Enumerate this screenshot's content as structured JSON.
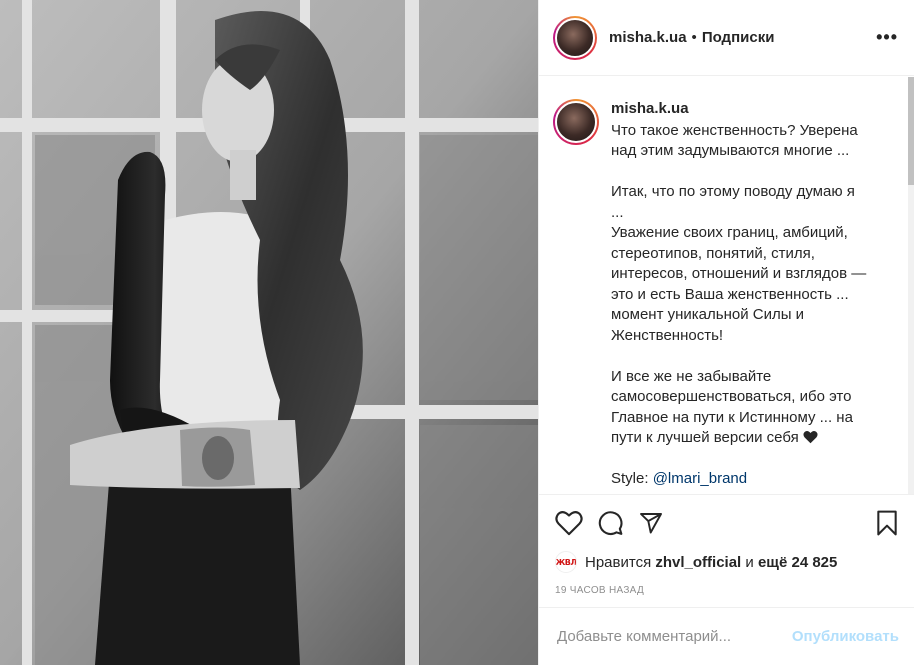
{
  "post": {
    "username": "misha.k.ua",
    "separator": "•",
    "follow_label": "Подписки",
    "more_icon": "more-horizontal-icon"
  },
  "caption": {
    "username": "misha.k.ua",
    "lines_1": [
      "Что такое женственность? Уверена",
      "над этим задумываются многие ..."
    ],
    "lines_2": [
      "Итак, что по этому поводу думаю я",
      "...",
      "Уважение своих границ, амбиций,",
      "стереотипов, понятий, стиля,",
      "интересов, отношений и взглядов —",
      "это и есть Ваша женственность ...",
      "момент уникальной Силы и",
      "Женственность!"
    ],
    "lines_3": [
      "И все же не забывайте",
      "самосовершенствоваться, ибо это",
      "Главное на пути к Истинному ... на",
      "пути к лучшей версии себя"
    ],
    "style_label": "Style: ",
    "style_mention": "@lmari_brand"
  },
  "actions": {
    "like_icon": "heart-icon",
    "comment_icon": "comment-icon",
    "share_icon": "share-icon",
    "save_icon": "bookmark-icon"
  },
  "likes": {
    "liker_avatar_text": "ЖВЛ",
    "prefix": "Нравится",
    "liker": "zhvl_official",
    "middle": "и",
    "others": "ещё 24 825"
  },
  "timestamp": "19 ЧАСОВ НАЗАД",
  "comment": {
    "placeholder": "Добавьте комментарий...",
    "publish_label": "Опубликовать"
  },
  "colors": {
    "mention": "#00376b",
    "publish_disabled": "#b2dffc",
    "meta_gray": "#8e8e8e"
  }
}
